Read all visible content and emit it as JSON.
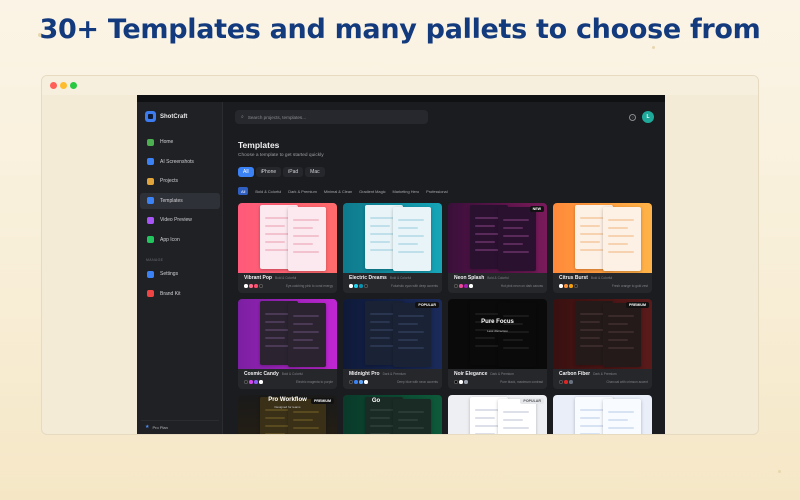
{
  "headline": "30+ Templates and many pallets to choose from",
  "colors": {
    "headline": "#123a7d",
    "accent": "#3b82f6",
    "app_bg": "#1b1c1f",
    "sidebar_bg": "#202125"
  },
  "window": {
    "traffic_lights": [
      "#ff5f57",
      "#febc2e",
      "#28c840"
    ]
  },
  "app": {
    "name": "ShotCraft",
    "logo_icon": "camera-icon",
    "sidebar": {
      "items": [
        {
          "label": "Home",
          "icon": "home-icon",
          "color": "#4caf50",
          "active": false
        },
        {
          "label": "AI Screenshots",
          "icon": "sparkle-icon",
          "color": "#3b82f6",
          "active": false
        },
        {
          "label": "Projects",
          "icon": "folder-icon",
          "color": "#e0a43a",
          "active": false
        },
        {
          "label": "Templates",
          "icon": "grid-icon",
          "color": "#3b82f6",
          "active": true
        },
        {
          "label": "Video Preview",
          "icon": "video-icon",
          "color": "#a855f7",
          "active": false
        },
        {
          "label": "App Icon",
          "icon": "app-icon",
          "color": "#22c55e",
          "active": false
        }
      ],
      "manage_label": "MANAGE",
      "manage_items": [
        {
          "label": "Settings",
          "icon": "gear-icon",
          "color": "#3b82f6"
        },
        {
          "label": "Brand Kit",
          "icon": "brush-icon",
          "color": "#ef4444"
        }
      ],
      "plan_label": "Pro Plan"
    },
    "search": {
      "placeholder": "Search projects, templates..."
    },
    "help_icon": "?",
    "avatar_initial": "L",
    "page_title": "Templates",
    "page_subtitle": "Choose a template to get started quickly",
    "device_tabs": [
      {
        "label": "All",
        "active": true
      },
      {
        "label": "iPhone",
        "active": false
      },
      {
        "label": "iPad",
        "active": false
      },
      {
        "label": "Mac",
        "active": false
      }
    ],
    "category_tabs": [
      {
        "label": "All",
        "active": true
      },
      {
        "label": "Bold & Colorful",
        "active": false
      },
      {
        "label": "Dark & Premium",
        "active": false
      },
      {
        "label": "Minimal & Clean",
        "active": false
      },
      {
        "label": "Gradient Magic",
        "active": false
      },
      {
        "label": "Marketing Hero",
        "active": false
      },
      {
        "label": "Professional",
        "active": false
      }
    ],
    "templates": [
      {
        "name": "Vibrant Pop",
        "category": "Bold & Colorful",
        "badge": "",
        "description": "Eye-catching pink to coral energy",
        "bg": "linear-gradient(90deg,#ff5a7a,#ff6b6b)",
        "phone": "#fbe9ef",
        "phone2": "#fbe9ef",
        "line": "#f2c2cf",
        "swatches": [
          "#ffffff",
          "#ff6b8a",
          "#ff4d6d",
          "#1f1f1f"
        ]
      },
      {
        "name": "Electric Dreams",
        "category": "Bold & Colorful",
        "badge": "",
        "description": "Futuristic cyan with deep accents",
        "bg": "linear-gradient(90deg,#0e7a8c,#16a5b8)",
        "phone": "#e8f4f7",
        "phone2": "#e8f4f7",
        "line": "#bfe0ea",
        "swatches": [
          "#ffffff",
          "#22d3ee",
          "#0891b2",
          "#1f1f1f"
        ]
      },
      {
        "name": "Neon Splash",
        "category": "Bold & Colorful",
        "badge": "NEW",
        "description": "Hot pink neon on dark canvas",
        "bg": "linear-gradient(90deg,#3a0f3a,#7a1a5a)",
        "phone": "#2a1130",
        "phone2": "#2a1130",
        "line": "#5a2a5a",
        "swatches": [
          "#1f1f1f",
          "#ec4899",
          "#a21caf",
          "#ffffff"
        ]
      },
      {
        "name": "Citrus Burst",
        "category": "Bold & Colorful",
        "badge": "",
        "description": "Fresh orange to gold zest",
        "bg": "linear-gradient(90deg,#ff8a3a,#ffb347)",
        "phone": "#fdf0e4",
        "phone2": "#fdf0e4",
        "line": "#f6d2b0",
        "swatches": [
          "#ffffff",
          "#fb923c",
          "#f59e0b",
          "#1f1f1f"
        ]
      },
      {
        "name": "Cosmic Candy",
        "category": "Bold & Colorful",
        "badge": "",
        "description": "Electric magenta to purple",
        "bg": "linear-gradient(90deg,#7b1fa2,#c026d3)",
        "phone": "#2b2330",
        "phone2": "#2b2330",
        "line": "#4a3a55",
        "swatches": [
          "#1f1f1f",
          "#d946ef",
          "#8b5cf6",
          "#ffffff"
        ]
      },
      {
        "name": "Midnight Pro",
        "category": "Dark & Premium",
        "badge": "POPULAR",
        "description": "Deep blue with neon accents",
        "bg": "linear-gradient(90deg,#0f1a3a,#1a2a5a)",
        "phone": "#1a2235",
        "phone2": "#1a2235",
        "line": "#2a3650",
        "swatches": [
          "#1f1f1f",
          "#3b82f6",
          "#60a5fa",
          "#ffffff"
        ]
      },
      {
        "name": "Noir Elegance",
        "category": "Dark & Premium",
        "badge": "",
        "description": "Pure black, maximum contrast",
        "bg": "#0a0a0a",
        "phone": "#0a0a0a",
        "phone2": "#0a0a0a",
        "line": "#1a1a1a",
        "swatches": [
          "#000000",
          "#ffffff",
          "#9ca3af"
        ],
        "big": "Pure Focus",
        "small": "Less distraction"
      },
      {
        "name": "Carbon Fiber",
        "category": "Dark & Premium",
        "badge": "PREMIUM",
        "description": "Charcoal with crimson accent",
        "bg": "linear-gradient(90deg,#3a1010,#5a1a1a)",
        "phone": "#241a1a",
        "phone2": "#241a1a",
        "line": "#3a2a2a",
        "swatches": [
          "#1f1f1f",
          "#dc2626",
          "#6b7280"
        ]
      },
      {
        "name": "",
        "category": "",
        "badge": "PREMIUM",
        "description": "",
        "bg": "linear-gradient(180deg,#1a1a1a,#2a2010)",
        "phone": "#3a3018",
        "phone2": "#3a3018",
        "line": "#5a4a20",
        "swatches": [],
        "big": "Pro Workflow",
        "small": "Designed for teams"
      },
      {
        "name": "",
        "category": "",
        "badge": "",
        "description": "",
        "bg": "linear-gradient(90deg,#0a3a2a,#0d5a3a)",
        "phone": "#1a2a25",
        "phone2": "#1a2a25",
        "line": "#2a3a35",
        "swatches": [],
        "big": "Go",
        "small": ""
      },
      {
        "name": "",
        "category": "",
        "badge": "POPULAR",
        "description": "",
        "bg": "#eeeff3",
        "phone": "#ffffff",
        "phone2": "#ffffff",
        "line": "#dde0e8",
        "swatches": []
      },
      {
        "name": "",
        "category": "",
        "badge": "",
        "description": "",
        "bg": "#e9eef8",
        "phone": "#f8fbff",
        "phone2": "#f8fbff",
        "line": "#d7e2f3",
        "swatches": []
      }
    ]
  }
}
